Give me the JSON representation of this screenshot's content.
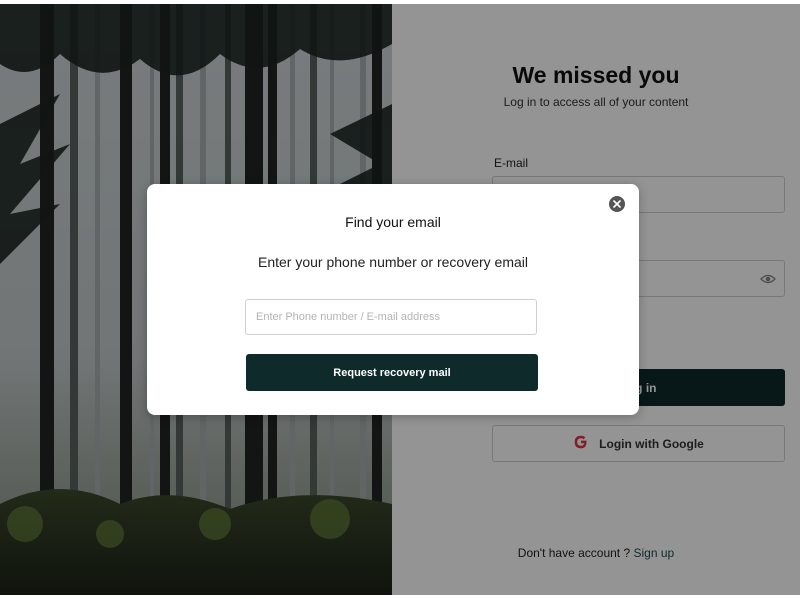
{
  "login": {
    "title": "We missed you",
    "subtitle": "Log in to access all of your content",
    "email_label": "E-mail",
    "login_button": "Log in",
    "google_button": "Login with Google",
    "no_account_text": "Don't have account ?",
    "signup_link": "Sign up"
  },
  "modal": {
    "title": "Find your email",
    "subtitle": "Enter your phone number or recovery email",
    "input_placeholder": "Enter Phone number / E-mail address",
    "input_value": "",
    "request_button": "Request recovery mail"
  },
  "icons": {
    "close": "close-icon",
    "eye": "eye-icon",
    "google": "google-icon"
  },
  "colors": {
    "primary_button": "#0e2a2a",
    "link": "#1d4f4f",
    "google_red": "#e0344a"
  }
}
